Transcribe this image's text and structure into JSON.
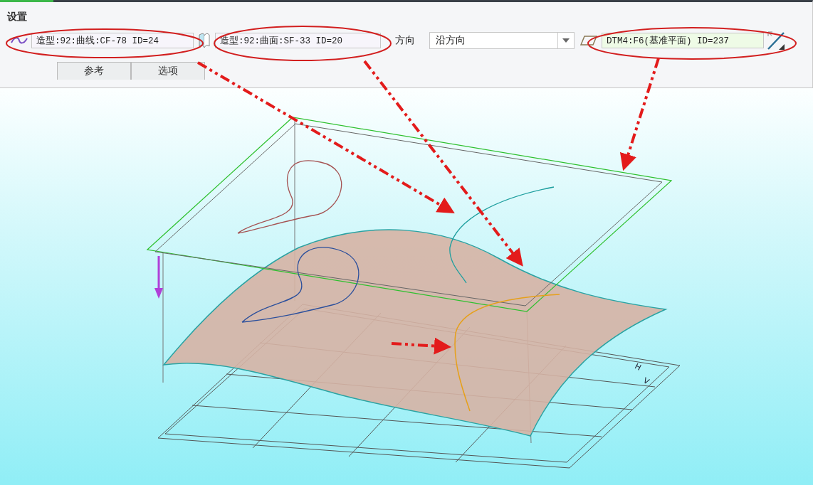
{
  "panel": {
    "title": "设置",
    "curve_field": {
      "value": "造型:92:曲线:CF-78 ID=24"
    },
    "surface_field": {
      "value": "造型:92:曲面:SF-33 ID=20"
    },
    "direction": {
      "label": "方向",
      "value": "沿方向"
    },
    "plane_field": {
      "value": "DTM4:F6(基准平面) ID=237"
    },
    "tabs": [
      {
        "label": "参考",
        "selected": false
      },
      {
        "label": "选项",
        "selected": false
      }
    ]
  },
  "viewport": {
    "view_labels": [
      "H",
      "V"
    ]
  }
}
